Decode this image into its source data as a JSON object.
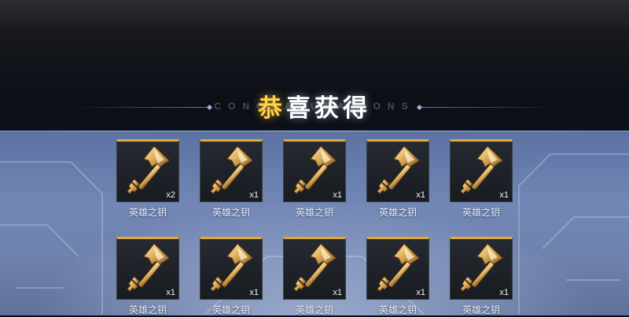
{
  "header": {
    "title_first": "恭",
    "title_rest": "喜获得",
    "subtitle": "CONGRATULATIONS"
  },
  "colors": {
    "accent_gold": "#e3a83a",
    "title_gold": "#ffd24a",
    "panel_blue": "#6f82ad"
  },
  "rewards": [
    {
      "name": "英雄之钥",
      "count": "x2",
      "icon": "hero-key-icon"
    },
    {
      "name": "英雄之钥",
      "count": "x1",
      "icon": "hero-key-icon"
    },
    {
      "name": "英雄之钥",
      "count": "x1",
      "icon": "hero-key-icon"
    },
    {
      "name": "英雄之钥",
      "count": "x1",
      "icon": "hero-key-icon"
    },
    {
      "name": "英雄之钥",
      "count": "x1",
      "icon": "hero-key-icon"
    },
    {
      "name": "英雄之钥",
      "count": "x1",
      "icon": "hero-key-icon"
    },
    {
      "name": "英雄之钥",
      "count": "x1",
      "icon": "hero-key-icon"
    },
    {
      "name": "英雄之钥",
      "count": "x1",
      "icon": "hero-key-icon"
    },
    {
      "name": "英雄之钥",
      "count": "x1",
      "icon": "hero-key-icon"
    },
    {
      "name": "英雄之钥",
      "count": "x1",
      "icon": "hero-key-icon"
    }
  ]
}
